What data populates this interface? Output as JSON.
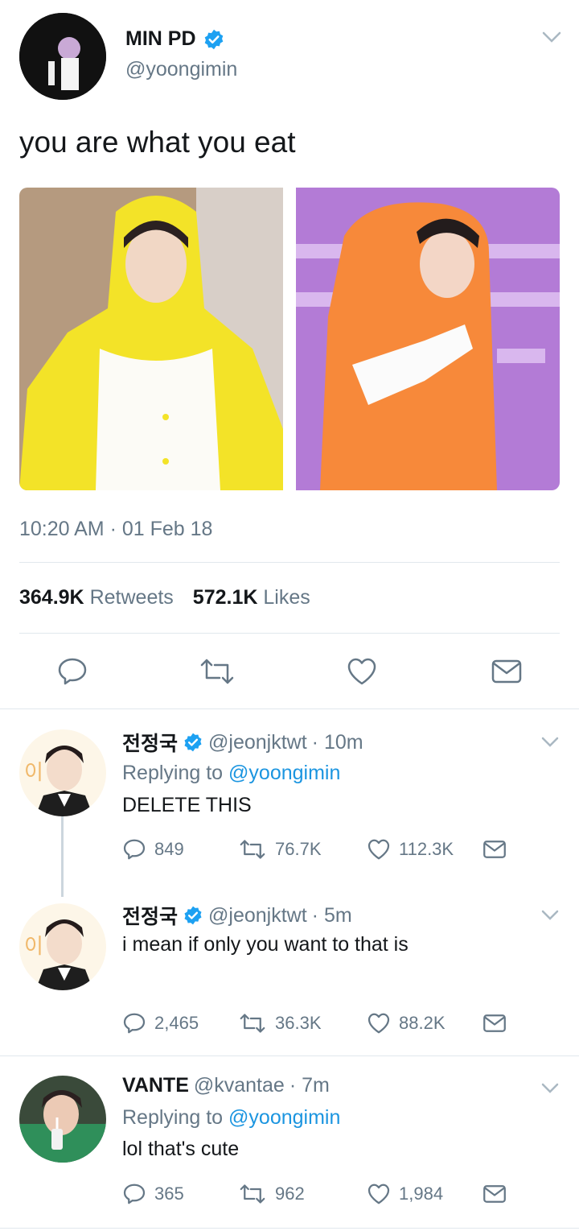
{
  "main_tweet": {
    "name": "MIN PD",
    "handle": "@yoongimin",
    "text": "you are what you eat",
    "timestamp": "10:20 AM · 01 Feb 18",
    "retweets_count": "364.9K",
    "retweets_label": "Retweets",
    "likes_count": "572.1K",
    "likes_label": "Likes",
    "icons": [
      "reply-icon",
      "retweet-icon",
      "like-icon",
      "direct-message-icon"
    ]
  },
  "replies": [
    {
      "name": "전정국",
      "handle": "@jeonjktwt",
      "time": "· 10m",
      "replying_prefix": "Replying to",
      "replying_to": "@yoongimin",
      "text": "DELETE THIS",
      "reply_count": "849",
      "retweet_count": "76.7K",
      "like_count": "112.3K"
    },
    {
      "name": "전정국",
      "handle": "@jeonjktwt",
      "time": "· 5m",
      "text": "i mean if only you want to that is",
      "reply_count": "2,465",
      "retweet_count": "36.3K",
      "like_count": "88.2K"
    },
    {
      "name": "VANTE",
      "handle": "@kvantae",
      "time": "· 7m",
      "replying_prefix": "Replying to",
      "replying_to": "@yoongimin",
      "text": "lol that's cute",
      "reply_count": "365",
      "retweet_count": "962",
      "like_count": "1,984"
    }
  ],
  "colors": {
    "accent": "#1b95e0",
    "muted_text": "#657786",
    "divider": "#e1e8ed",
    "verified": "#1da1f2"
  }
}
